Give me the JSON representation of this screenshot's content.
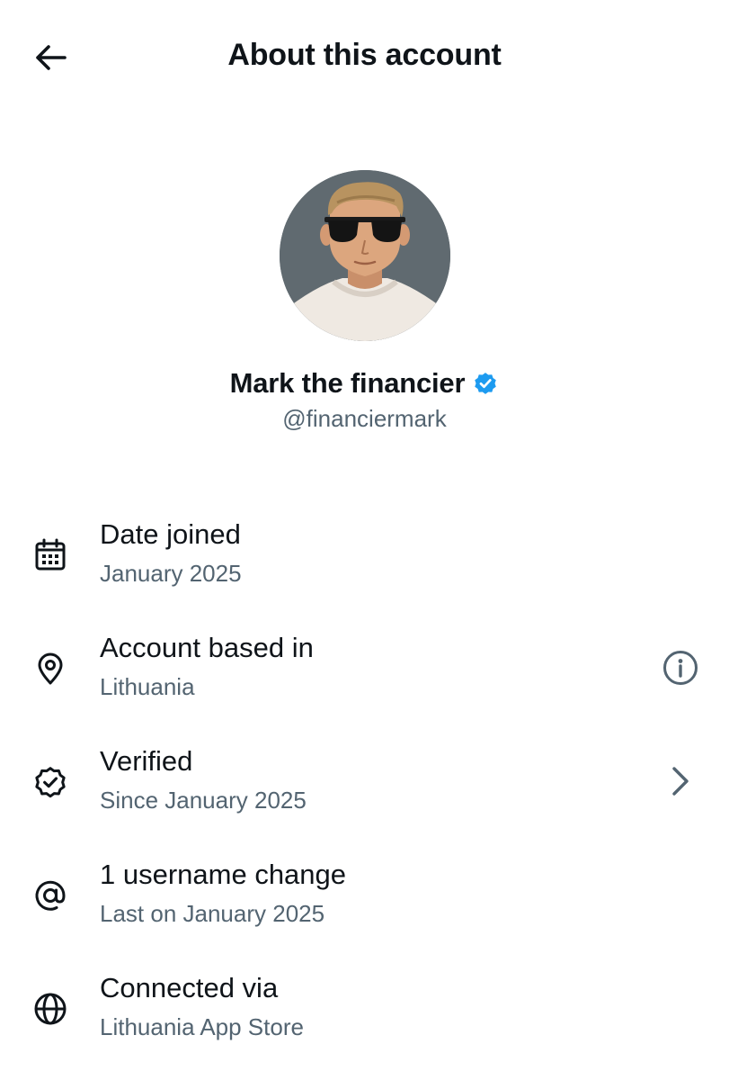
{
  "header": {
    "title": "About this account",
    "back_icon": "arrow-left-icon"
  },
  "profile": {
    "display_name": "Mark the financier",
    "handle": "@financiermark",
    "verified_badge_color": "#1d9bf0"
  },
  "details": [
    {
      "icon": "calendar-icon",
      "label": "Date joined",
      "value": "January 2025",
      "trailing_icon": null
    },
    {
      "icon": "location-pin-icon",
      "label": "Account based in",
      "value": "Lithuania",
      "trailing_icon": "info-icon"
    },
    {
      "icon": "verified-icon",
      "label": "Verified",
      "value": "Since January 2025",
      "trailing_icon": "chevron-right-icon"
    },
    {
      "icon": "at-sign-icon",
      "label": "1 username change",
      "value": "Last on January 2025",
      "trailing_icon": null
    },
    {
      "icon": "globe-icon",
      "label": "Connected via",
      "value": "Lithuania App Store",
      "trailing_icon": null
    }
  ],
  "colors": {
    "text_primary": "#0f1419",
    "text_secondary": "#536471",
    "background": "#ffffff"
  }
}
